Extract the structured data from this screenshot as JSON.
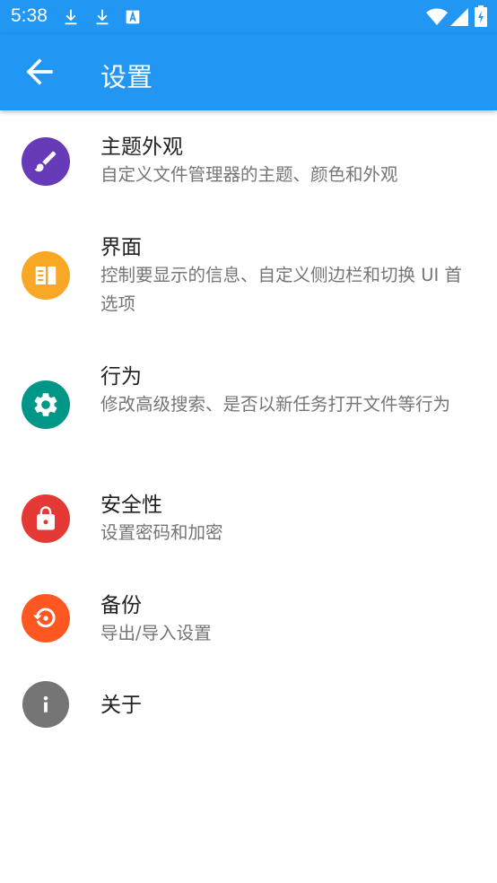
{
  "status_bar": {
    "time": "5:38",
    "left_icons": [
      "download-icon",
      "download-icon",
      "app-icon"
    ],
    "right_icons": [
      "wifi-icon",
      "signal-icon",
      "battery-charging-icon"
    ]
  },
  "app_bar": {
    "title": "设置",
    "color": "#2196F3",
    "back_icon": "arrow-back-icon"
  },
  "settings": [
    {
      "title": "主题外观",
      "subtitle": "自定义文件管理器的主题、颜色和外观",
      "icon": "brush-icon",
      "color": "#673AB7"
    },
    {
      "title": "界面",
      "subtitle": "控制要显示的信息、自定义侧边栏和切换 UI 首选项",
      "icon": "view-quilt-icon",
      "color": "#F9A825"
    },
    {
      "title": "行为",
      "subtitle": "修改高级搜索、是否以新任务打开文件等行为",
      "icon": "gear-icon",
      "color": "#009688"
    },
    {
      "title": "安全性",
      "subtitle": "设置密码和加密",
      "icon": "lock-icon",
      "color": "#E53935"
    },
    {
      "title": "备份",
      "subtitle": "导出/导入设置",
      "icon": "restore-icon",
      "color": "#FF5722"
    },
    {
      "title": "关于",
      "subtitle": "",
      "icon": "info-icon",
      "color": "#757575"
    }
  ]
}
